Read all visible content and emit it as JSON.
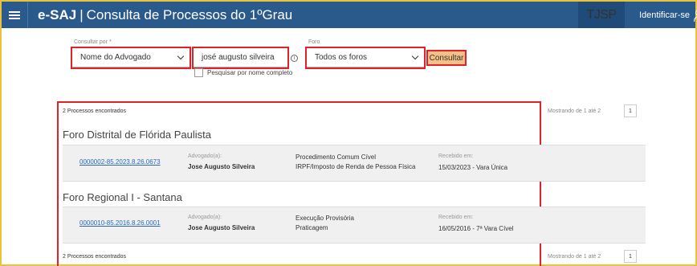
{
  "header": {
    "app_name": "e-SAJ",
    "separator": "|",
    "title": "Consulta de Processos do 1ºGrau",
    "brand": "TJSP",
    "login_label": "Identificar-se"
  },
  "search": {
    "consultar_por_label": "Consultar por *",
    "consultar_por_value": "Nome do Advogado",
    "name_value": "josé augusto silveira",
    "full_name_checkbox_label": "Pesquisar por nome completo",
    "foro_label": "Foro",
    "foro_value": "Todos os foros",
    "submit_label": "Consultar"
  },
  "results": {
    "count_top": "2 Processos encontrados",
    "count_bottom": "2 Processos encontrados",
    "paging_top": "Mostrando de 1 até 2",
    "paging_bottom": "Mostrando de 1 até 2",
    "page": "1",
    "groups": [
      {
        "foro": "Foro Distrital de Flórida Paulista",
        "process_number": "0000002-85.2023.8.26.0673",
        "lawyer_label": "Advogado(a):",
        "lawyer_name": "Jose Augusto Silveira",
        "class": "Procedimento Comum Cível",
        "subject": "IRPF/Imposto de Renda de Pessoa Física",
        "received_label": "Recebido em:",
        "received_value": "15/03/2023 - Vara Única"
      },
      {
        "foro": "Foro Regional I - Santana",
        "process_number": "0000010-85.2016.8.26.0001",
        "lawyer_label": "Advogado(a):",
        "lawyer_name": "Jose Augusto Silveira",
        "class": "Execução Provisória",
        "subject": "Praticagem",
        "received_label": "Recebido em:",
        "received_value": "16/05/2016 - 7ª Vara Cível"
      }
    ]
  },
  "colors": {
    "header_bg": "#2a5a8c",
    "highlight": "#e0202a",
    "button_bg": "#f5c088",
    "link": "#2a6ab8"
  }
}
